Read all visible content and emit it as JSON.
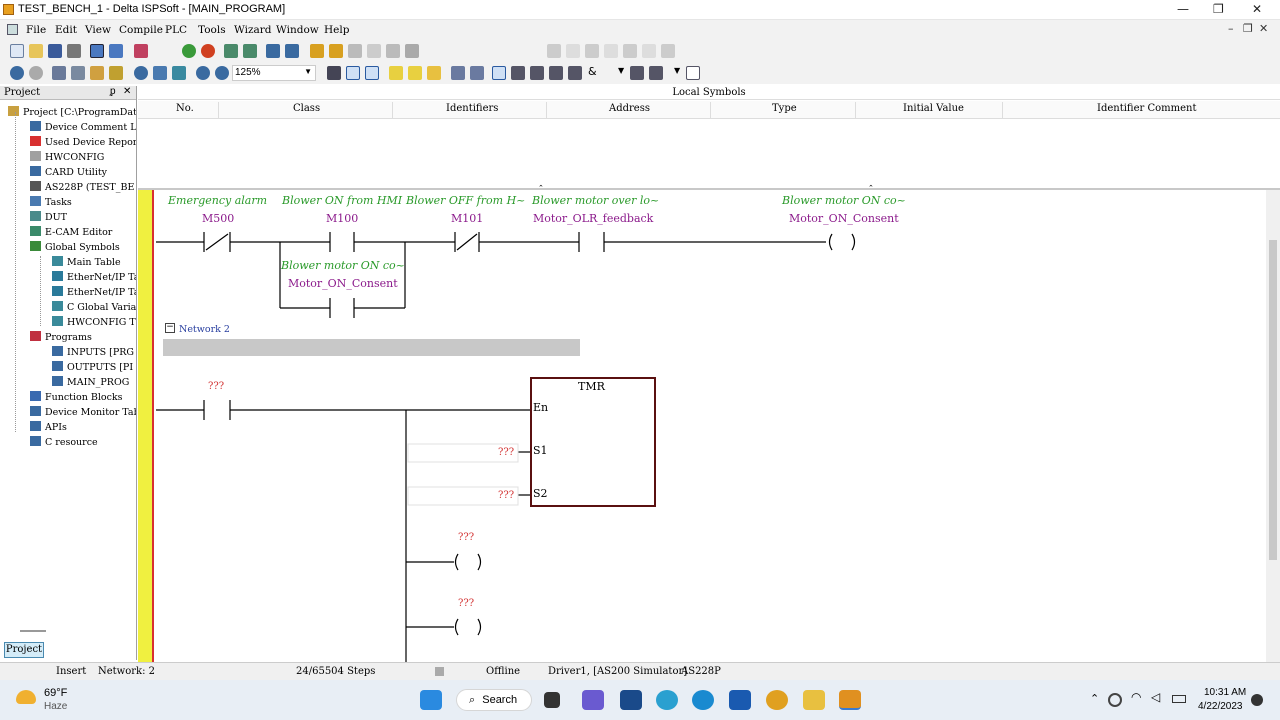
{
  "window": {
    "title": "TEST_BENCH_1 - Delta ISPSoft - [MAIN_PROGRAM]"
  },
  "menu": [
    "File",
    "Edit",
    "View",
    "Compile",
    "PLC",
    "Tools",
    "Wizard",
    "Window",
    "Help"
  ],
  "toolbar": {
    "zoom": "125%"
  },
  "project_panel": {
    "title": "Project",
    "tab": "Project",
    "items": [
      {
        "label": "Project [C:\\ProgramData\\D"
      },
      {
        "label": "Device Comment Lis"
      },
      {
        "label": "Used Device Report"
      },
      {
        "label": "HWCONFIG"
      },
      {
        "label": "CARD Utility"
      },
      {
        "label": "AS228P  (TEST_BE"
      },
      {
        "label": "Tasks"
      },
      {
        "label": "DUT"
      },
      {
        "label": "E-CAM Editor"
      },
      {
        "label": "Global Symbols"
      },
      {
        "label": "Main Table"
      },
      {
        "label": "EtherNet/IP Ta"
      },
      {
        "label": "EtherNet/IP Ta"
      },
      {
        "label": "C Global Variak"
      },
      {
        "label": "HWCONFIG T"
      },
      {
        "label": "Programs"
      },
      {
        "label": "INPUTS [PRG"
      },
      {
        "label": "OUTPUTS [PI"
      },
      {
        "label": "MAIN_PROG"
      },
      {
        "label": "Function Blocks"
      },
      {
        "label": "Device Monitor Tab"
      },
      {
        "label": "APIs"
      },
      {
        "label": "C resource"
      }
    ]
  },
  "local_symbols": {
    "title": "Local Symbols",
    "columns": [
      "No.",
      "Class",
      "Identifiers",
      "Address",
      "Type",
      "Initial Value",
      "Identifier Comment"
    ]
  },
  "ladder": {
    "network1": {
      "contacts": [
        {
          "comment": "Emergency alarm",
          "var": "M500"
        },
        {
          "comment": "Blower ON from HMI",
          "var": "M100"
        },
        {
          "comment": "Blower OFF from H~",
          "var": "M101"
        },
        {
          "comment": "Blower motor over lo~",
          "var": "Motor_OLR_feedback"
        }
      ],
      "coil": {
        "comment": "Blower motor ON co~",
        "var": "Motor_ON_Consent"
      },
      "branch": {
        "comment": "Blower motor ON co~",
        "var": "Motor_ON_Consent"
      }
    },
    "network2": {
      "label": "Network 2",
      "contact": "???",
      "block": {
        "name": "TMR",
        "pins": [
          "En",
          "S1",
          "S2"
        ]
      },
      "s1": "???",
      "s2": "???",
      "coil1": "???",
      "coil2": "???"
    }
  },
  "status": {
    "mode": "Insert",
    "network": "Network: 2",
    "steps": "24/65504 Steps",
    "state": "Offline",
    "driver": "Driver1, [AS200 Simulator]",
    "model": "AS228P"
  },
  "taskbar": {
    "temp": "69°F",
    "weather": "Haze",
    "search": "Search",
    "time": "10:31 AM",
    "date": "4/22/2023"
  }
}
